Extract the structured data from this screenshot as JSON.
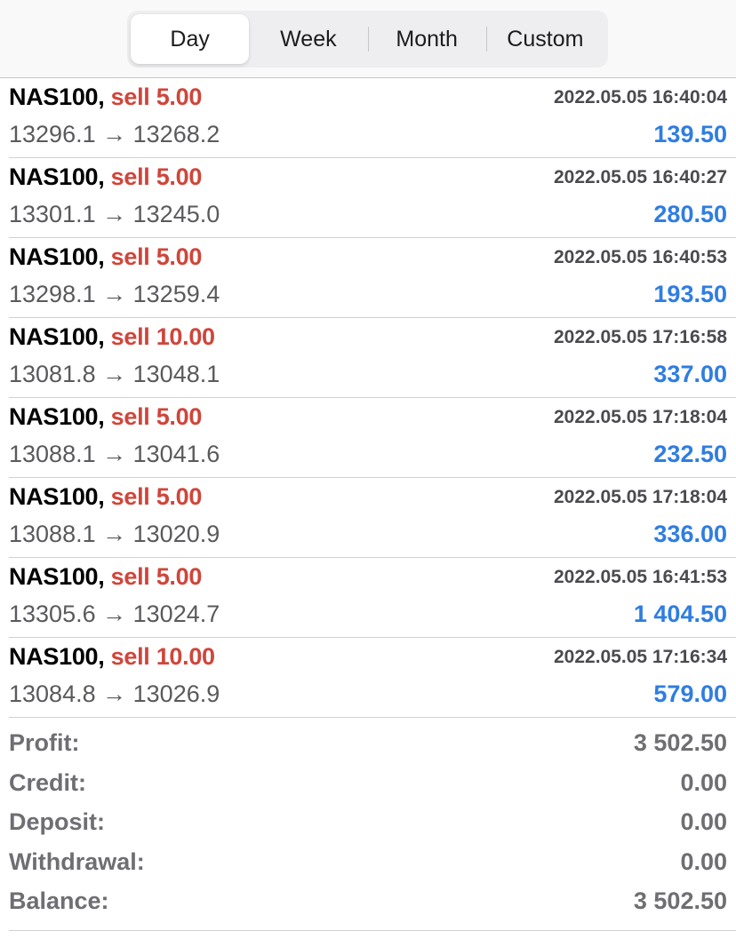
{
  "tabs": [
    {
      "label": "Day",
      "active": true
    },
    {
      "label": "Week",
      "active": false
    },
    {
      "label": "Month",
      "active": false
    },
    {
      "label": "Custom",
      "active": false
    }
  ],
  "arrow": "→",
  "deals": [
    {
      "symbol": "NAS100,",
      "side": "sell 5.00",
      "time": "2022.05.05 16:40:04",
      "open": "13296.1",
      "close": "13268.2",
      "profit": "139.50"
    },
    {
      "symbol": "NAS100,",
      "side": "sell 5.00",
      "time": "2022.05.05 16:40:27",
      "open": "13301.1",
      "close": "13245.0",
      "profit": "280.50"
    },
    {
      "symbol": "NAS100,",
      "side": "sell 5.00",
      "time": "2022.05.05 16:40:53",
      "open": "13298.1",
      "close": "13259.4",
      "profit": "193.50"
    },
    {
      "symbol": "NAS100,",
      "side": "sell 10.00",
      "time": "2022.05.05 17:16:58",
      "open": "13081.8",
      "close": "13048.1",
      "profit": "337.00"
    },
    {
      "symbol": "NAS100,",
      "side": "sell 5.00",
      "time": "2022.05.05 17:18:04",
      "open": "13088.1",
      "close": "13041.6",
      "profit": "232.50"
    },
    {
      "symbol": "NAS100,",
      "side": "sell 5.00",
      "time": "2022.05.05 17:18:04",
      "open": "13088.1",
      "close": "13020.9",
      "profit": "336.00"
    },
    {
      "symbol": "NAS100,",
      "side": "sell 5.00",
      "time": "2022.05.05 16:41:53",
      "open": "13305.6",
      "close": "13024.7",
      "profit": "1 404.50"
    },
    {
      "symbol": "NAS100,",
      "side": "sell 10.00",
      "time": "2022.05.05 17:16:34",
      "open": "13084.8",
      "close": "13026.9",
      "profit": "579.00"
    }
  ],
  "summary": [
    {
      "label": "Profit:",
      "value": "3 502.50"
    },
    {
      "label": "Credit:",
      "value": "0.00"
    },
    {
      "label": "Deposit:",
      "value": "0.00"
    },
    {
      "label": "Withdrawal:",
      "value": "0.00"
    },
    {
      "label": "Balance:",
      "value": "3 502.50"
    }
  ],
  "colors": {
    "sell": "#d0453a",
    "profit": "#2f7de1",
    "summary_text": "#6e6e73"
  }
}
